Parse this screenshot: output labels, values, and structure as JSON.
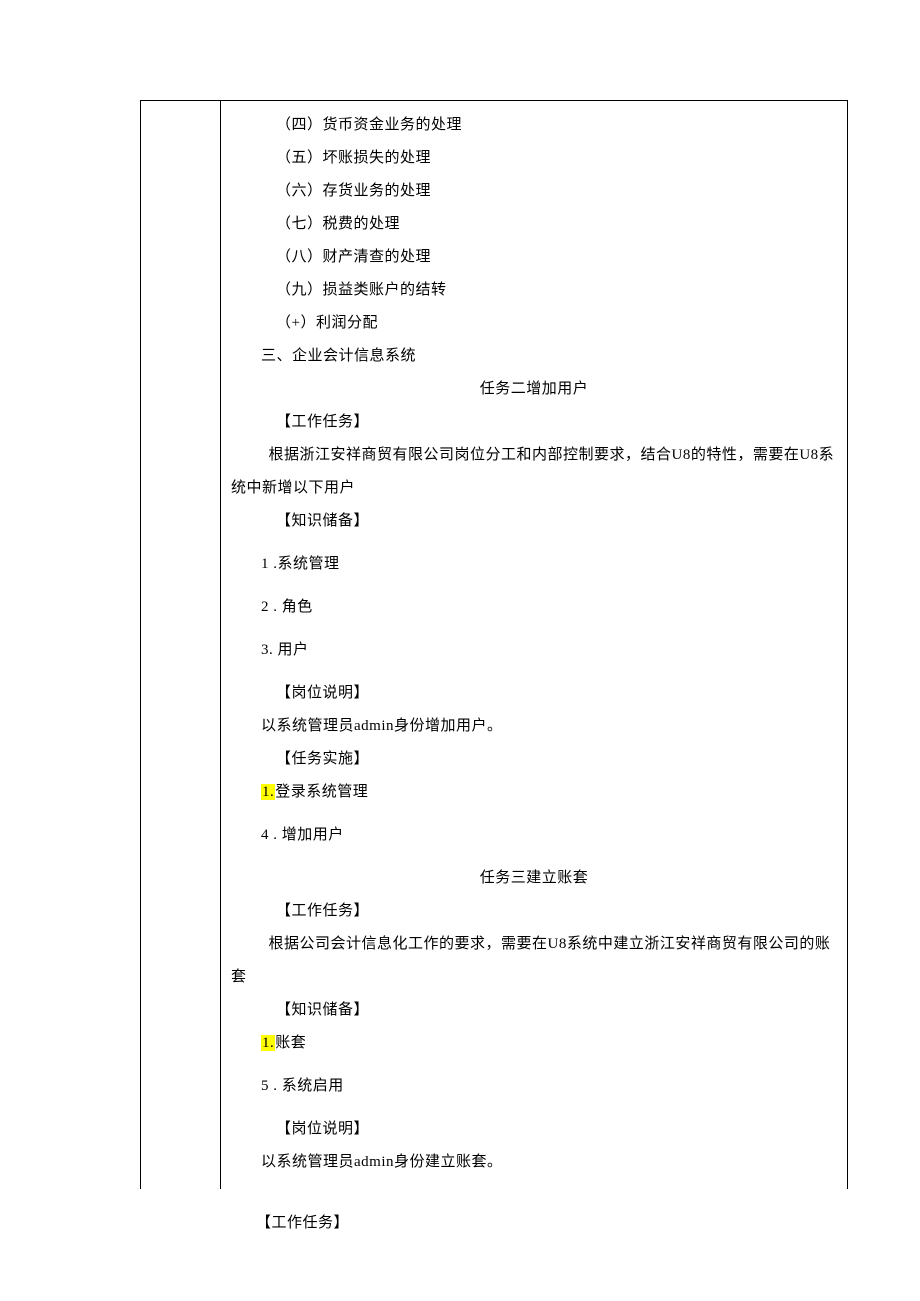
{
  "body": {
    "items": [
      "（四）货币资金业务的处理",
      "（五）坏账损失的处理",
      "（六）存货业务的处理",
      "（七）税费的处理",
      "（八）财产清查的处理",
      "（九）损益类账户的结转",
      "（+）利润分配"
    ],
    "section": "三、企业会计信息系统",
    "task2_title": "任务二增加用户",
    "task2_work_label": "【工作任务】",
    "task2_work_body": "根据浙江安祥商贸有限公司岗位分工和内部控制要求，结合U8的特性，需要在U8系统中新增以下用户",
    "task2_knowledge_label": "【知识储备】",
    "task2_knowledge": [
      "1 .系统管理",
      "2 . 角色",
      "3. 用户"
    ],
    "task2_post_label": "【岗位说明】",
    "task2_post_body": "以系统管理员admin身份增加用户。",
    "task2_impl_label": "【任务实施】",
    "task2_impl_hl": "1.",
    "task2_impl_1": "登录系统管理",
    "task2_impl_2": "4 . 增加用户",
    "task3_title": "任务三建立账套",
    "task3_work_label": "【工作任务】",
    "task3_work_body": "根据公司会计信息化工作的要求，需要在U8系统中建立浙江安祥商贸有限公司的账套",
    "task3_knowledge_label": "【知识储备】",
    "task3_k_hl": "1.",
    "task3_k_1": "账套",
    "task3_k_2": "5 . 系统启用",
    "task3_post_label": "【岗位说明】",
    "task3_post_body": "以系统管理员admin身份建立账套。"
  },
  "footer": "【工作任务】"
}
